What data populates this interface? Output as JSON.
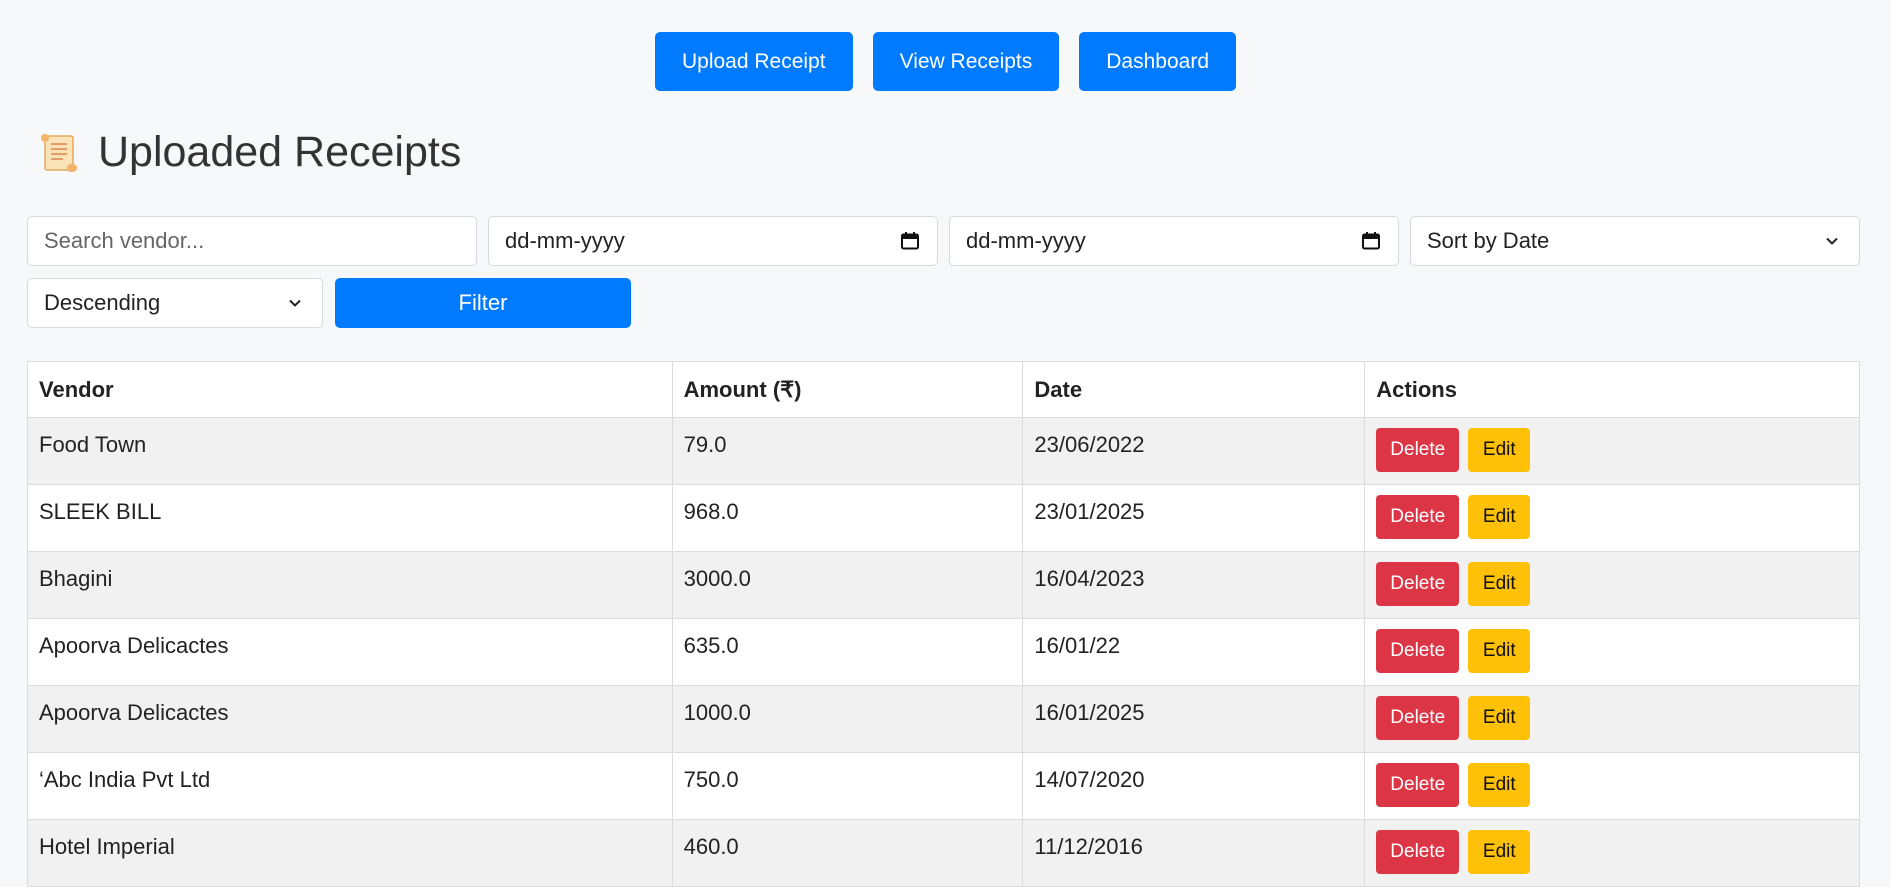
{
  "nav": {
    "upload_label": "Upload Receipt",
    "view_label": "View Receipts",
    "dashboard_label": "Dashboard"
  },
  "page": {
    "title": "Uploaded Receipts",
    "title_icon": "scroll-icon"
  },
  "filters": {
    "search_placeholder": "Search vendor...",
    "start_date_placeholder": "dd-mm-yyyy",
    "end_date_placeholder": "dd-mm-yyyy",
    "date_icon": "calendar-icon",
    "sort_by_selected": "Sort by Date",
    "order_selected": "Descending",
    "filter_label": "Filter"
  },
  "table": {
    "headers": {
      "vendor": "Vendor",
      "amount": "Amount (₹)",
      "date": "Date",
      "actions": "Actions"
    },
    "delete_label": "Delete",
    "edit_label": "Edit",
    "rows": [
      {
        "vendor": "Food Town",
        "amount": "79.0",
        "date": "23/06/2022"
      },
      {
        "vendor": "SLEEK BILL",
        "amount": "968.0",
        "date": "23/01/2025"
      },
      {
        "vendor": "Bhagini",
        "amount": "3000.0",
        "date": "16/04/2023"
      },
      {
        "vendor": "Apoorva Delicactes",
        "amount": "635.0",
        "date": "16/01/22"
      },
      {
        "vendor": "Apoorva Delicactes",
        "amount": "1000.0",
        "date": "16/01/2025"
      },
      {
        "vendor": "‘Abc India Pvt Ltd",
        "amount": "750.0",
        "date": "14/07/2020"
      },
      {
        "vendor": "Hotel Imperial",
        "amount": "460.0",
        "date": "11/12/2016"
      }
    ]
  },
  "colors": {
    "primary": "#007bff",
    "danger": "#dc3545",
    "warning": "#ffc107",
    "background": "#f7f8fa"
  }
}
